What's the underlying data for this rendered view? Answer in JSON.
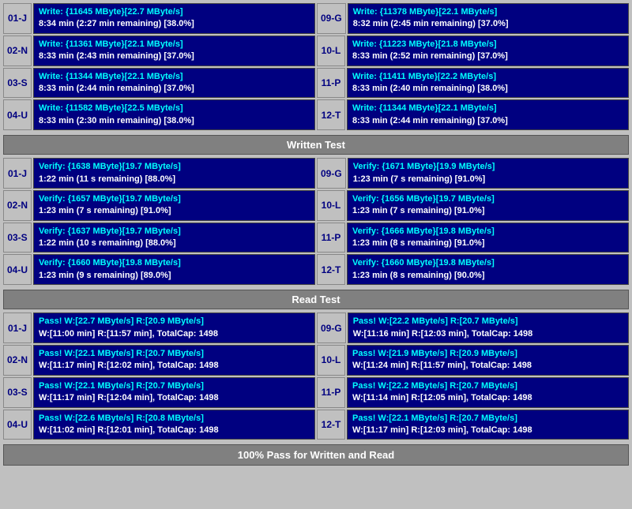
{
  "sections": {
    "write_test": {
      "label": "Written Test",
      "rows_left": [
        {
          "id": "01-J",
          "line1": "Write: {11645 MByte}[22.7 MByte/s]",
          "line2": "8:34 min (2:27 min remaining)  [38.0%]"
        },
        {
          "id": "02-N",
          "line1": "Write: {11361 MByte}[22.1 MByte/s]",
          "line2": "8:33 min (2:43 min remaining)  [37.0%]"
        },
        {
          "id": "03-S",
          "line1": "Write: {11344 MByte}[22.1 MByte/s]",
          "line2": "8:33 min (2:44 min remaining)  [37.0%]"
        },
        {
          "id": "04-U",
          "line1": "Write: {11582 MByte}[22.5 MByte/s]",
          "line2": "8:33 min (2:30 min remaining)  [38.0%]"
        }
      ],
      "rows_right": [
        {
          "id": "09-G",
          "line1": "Write: {11378 MByte}[22.1 MByte/s]",
          "line2": "8:32 min (2:45 min remaining)  [37.0%]"
        },
        {
          "id": "10-L",
          "line1": "Write: {11223 MByte}[21.8 MByte/s]",
          "line2": "8:33 min (2:52 min remaining)  [37.0%]"
        },
        {
          "id": "11-P",
          "line1": "Write: {11411 MByte}[22.2 MByte/s]",
          "line2": "8:33 min (2:40 min remaining)  [38.0%]"
        },
        {
          "id": "12-T",
          "line1": "Write: {11344 MByte}[22.1 MByte/s]",
          "line2": "8:33 min (2:44 min remaining)  [37.0%]"
        }
      ]
    },
    "verify_test": {
      "label": "Written Test",
      "rows_left": [
        {
          "id": "01-J",
          "line1": "Verify: {1638 MByte}[19.7 MByte/s]",
          "line2": "1:22 min (11 s remaining)   [88.0%]"
        },
        {
          "id": "02-N",
          "line1": "Verify: {1657 MByte}[19.7 MByte/s]",
          "line2": "1:23 min (7 s remaining)   [91.0%]"
        },
        {
          "id": "03-S",
          "line1": "Verify: {1637 MByte}[19.7 MByte/s]",
          "line2": "1:22 min (10 s remaining)   [88.0%]"
        },
        {
          "id": "04-U",
          "line1": "Verify: {1660 MByte}[19.8 MByte/s]",
          "line2": "1:23 min (9 s remaining)   [89.0%]"
        }
      ],
      "rows_right": [
        {
          "id": "09-G",
          "line1": "Verify: {1671 MByte}[19.9 MByte/s]",
          "line2": "1:23 min (7 s remaining)   [91.0%]"
        },
        {
          "id": "10-L",
          "line1": "Verify: {1656 MByte}[19.7 MByte/s]",
          "line2": "1:23 min (7 s remaining)   [91.0%]"
        },
        {
          "id": "11-P",
          "line1": "Verify: {1666 MByte}[19.8 MByte/s]",
          "line2": "1:23 min (8 s remaining)   [91.0%]"
        },
        {
          "id": "12-T",
          "line1": "Verify: {1660 MByte}[19.8 MByte/s]",
          "line2": "1:23 min (8 s remaining)   [90.0%]"
        }
      ]
    },
    "read_test": {
      "label": "Read Test",
      "rows_left": [
        {
          "id": "01-J",
          "line1": "Pass! W:[22.7 MByte/s] R:[20.9 MByte/s]",
          "line2": " W:[11:00 min] R:[11:57 min], TotalCap: 1498"
        },
        {
          "id": "02-N",
          "line1": "Pass! W:[22.1 MByte/s] R:[20.7 MByte/s]",
          "line2": " W:[11:17 min] R:[12:02 min], TotalCap: 1498"
        },
        {
          "id": "03-S",
          "line1": "Pass! W:[22.1 MByte/s] R:[20.7 MByte/s]",
          "line2": " W:[11:17 min] R:[12:04 min], TotalCap: 1498"
        },
        {
          "id": "04-U",
          "line1": "Pass! W:[22.6 MByte/s] R:[20.8 MByte/s]",
          "line2": " W:[11:02 min] R:[12:01 min], TotalCap: 1498"
        }
      ],
      "rows_right": [
        {
          "id": "09-G",
          "line1": "Pass! W:[22.2 MByte/s] R:[20.7 MByte/s]",
          "line2": " W:[11:16 min] R:[12:03 min], TotalCap: 1498"
        },
        {
          "id": "10-L",
          "line1": "Pass! W:[21.9 MByte/s] R:[20.9 MByte/s]",
          "line2": " W:[11:24 min] R:[11:57 min], TotalCap: 1498"
        },
        {
          "id": "11-P",
          "line1": "Pass! W:[22.2 MByte/s] R:[20.7 MByte/s]",
          "line2": " W:[11:14 min] R:[12:05 min], TotalCap: 1498"
        },
        {
          "id": "12-T",
          "line1": "Pass! W:[22.1 MByte/s] R:[20.7 MByte/s]",
          "line2": " W:[11:17 min] R:[12:03 min], TotalCap: 1498"
        }
      ]
    }
  },
  "headers": {
    "written_test": "Written Test",
    "read_test": "Read Test"
  },
  "footer": {
    "label": "100% Pass for Written and Read"
  }
}
